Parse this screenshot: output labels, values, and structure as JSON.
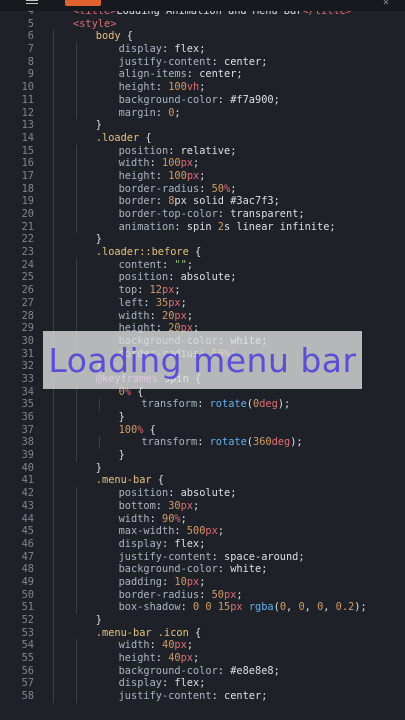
{
  "editor": {
    "lines": [
      {
        "n": "4",
        "indent": 3,
        "tokens": [
          [
            "t-tag",
            "<title>"
          ],
          [
            "t-plain",
            "Loading Animation and Menu Bar"
          ],
          [
            "t-tag",
            "</title>"
          ]
        ]
      },
      {
        "n": "5",
        "indent": 3,
        "tokens": [
          [
            "t-tag",
            "<style>"
          ]
        ]
      },
      {
        "n": "6",
        "indent": 4,
        "tokens": [
          [
            "t-sel",
            "body"
          ],
          [
            "t-plain",
            " {"
          ]
        ]
      },
      {
        "n": "7",
        "indent": 5,
        "tokens": [
          [
            "t-prop",
            "display"
          ],
          [
            "t-plain",
            ": flex;"
          ]
        ]
      },
      {
        "n": "8",
        "indent": 5,
        "tokens": [
          [
            "t-prop",
            "justify-content"
          ],
          [
            "t-plain",
            ": center;"
          ]
        ]
      },
      {
        "n": "9",
        "indent": 5,
        "tokens": [
          [
            "t-prop",
            "align-items"
          ],
          [
            "t-plain",
            ": center;"
          ]
        ]
      },
      {
        "n": "10",
        "indent": 5,
        "tokens": [
          [
            "t-prop",
            "height"
          ],
          [
            "t-plain",
            ": "
          ],
          [
            "t-num",
            "100"
          ],
          [
            "t-unit",
            "vh"
          ],
          [
            "t-plain",
            ";"
          ]
        ]
      },
      {
        "n": "11",
        "indent": 5,
        "tokens": [
          [
            "t-prop",
            "background-color"
          ],
          [
            "t-plain",
            ": #f7a900;"
          ]
        ]
      },
      {
        "n": "12",
        "indent": 5,
        "tokens": [
          [
            "t-prop",
            "margin"
          ],
          [
            "t-plain",
            ": "
          ],
          [
            "t-num",
            "0"
          ],
          [
            "t-plain",
            ";"
          ]
        ]
      },
      {
        "n": "13",
        "indent": 4,
        "tokens": [
          [
            "t-plain",
            "}"
          ]
        ]
      },
      {
        "n": "14",
        "indent": 4,
        "tokens": [
          [
            "t-sel",
            ".loader"
          ],
          [
            "t-plain",
            " {"
          ]
        ]
      },
      {
        "n": "15",
        "indent": 5,
        "tokens": [
          [
            "t-prop",
            "position"
          ],
          [
            "t-plain",
            ": relative;"
          ]
        ]
      },
      {
        "n": "16",
        "indent": 5,
        "tokens": [
          [
            "t-prop",
            "width"
          ],
          [
            "t-plain",
            ": "
          ],
          [
            "t-num",
            "100"
          ],
          [
            "t-unit",
            "px"
          ],
          [
            "t-plain",
            ";"
          ]
        ]
      },
      {
        "n": "17",
        "indent": 5,
        "tokens": [
          [
            "t-prop",
            "height"
          ],
          [
            "t-plain",
            ": "
          ],
          [
            "t-num",
            "100"
          ],
          [
            "t-unit",
            "px"
          ],
          [
            "t-plain",
            ";"
          ]
        ]
      },
      {
        "n": "18",
        "indent": 5,
        "tokens": [
          [
            "t-prop",
            "border-radius"
          ],
          [
            "t-plain",
            ": "
          ],
          [
            "t-num",
            "50"
          ],
          [
            "t-unit",
            "%"
          ],
          [
            "t-plain",
            ";"
          ]
        ]
      },
      {
        "n": "19",
        "indent": 5,
        "tokens": [
          [
            "t-prop",
            "border"
          ],
          [
            "t-plain",
            ": "
          ],
          [
            "t-num",
            "8"
          ],
          [
            "t-plain",
            "px solid #3ac7f3;"
          ]
        ]
      },
      {
        "n": "20",
        "indent": 5,
        "tokens": [
          [
            "t-prop",
            "border-top-color"
          ],
          [
            "t-plain",
            ": transparent;"
          ]
        ]
      },
      {
        "n": "21",
        "indent": 5,
        "tokens": [
          [
            "t-prop",
            "animation"
          ],
          [
            "t-plain",
            ": spin "
          ],
          [
            "t-num",
            "2"
          ],
          [
            "t-plain",
            "s linear infinite;"
          ]
        ]
      },
      {
        "n": "22",
        "indent": 4,
        "tokens": [
          [
            "t-plain",
            "}"
          ]
        ]
      },
      {
        "n": "23",
        "indent": 4,
        "tokens": [
          [
            "t-sel",
            ".loader::before"
          ],
          [
            "t-plain",
            " {"
          ]
        ]
      },
      {
        "n": "24",
        "indent": 5,
        "tokens": [
          [
            "t-prop",
            "content"
          ],
          [
            "t-plain",
            ": "
          ],
          [
            "t-str",
            "\"\""
          ],
          [
            "t-plain",
            ";"
          ]
        ]
      },
      {
        "n": "25",
        "indent": 5,
        "tokens": [
          [
            "t-prop",
            "position"
          ],
          [
            "t-plain",
            ": absolute;"
          ]
        ]
      },
      {
        "n": "26",
        "indent": 5,
        "tokens": [
          [
            "t-prop",
            "top"
          ],
          [
            "t-plain",
            ": "
          ],
          [
            "t-num",
            "12"
          ],
          [
            "t-unit",
            "px"
          ],
          [
            "t-plain",
            ";"
          ]
        ]
      },
      {
        "n": "27",
        "indent": 5,
        "tokens": [
          [
            "t-prop",
            "left"
          ],
          [
            "t-plain",
            ": "
          ],
          [
            "t-num",
            "35"
          ],
          [
            "t-unit",
            "px"
          ],
          [
            "t-plain",
            ";"
          ]
        ]
      },
      {
        "n": "28",
        "indent": 5,
        "tokens": [
          [
            "t-prop",
            "width"
          ],
          [
            "t-plain",
            ": "
          ],
          [
            "t-num",
            "20"
          ],
          [
            "t-unit",
            "px"
          ],
          [
            "t-plain",
            ";"
          ]
        ]
      },
      {
        "n": "29",
        "indent": 5,
        "tokens": [
          [
            "t-prop",
            "height"
          ],
          [
            "t-plain",
            ": "
          ],
          [
            "t-num",
            "20"
          ],
          [
            "t-unit",
            "px"
          ],
          [
            "t-plain",
            ";"
          ]
        ]
      },
      {
        "n": "30",
        "indent": 5,
        "tokens": [
          [
            "t-prop",
            "background-color"
          ],
          [
            "t-plain",
            ": white;"
          ]
        ]
      },
      {
        "n": "31",
        "indent": 5,
        "tokens": [
          [
            "t-prop",
            "border-radius"
          ],
          [
            "t-plain",
            ": "
          ],
          [
            "t-num",
            "50"
          ],
          [
            "t-unit",
            "%"
          ],
          [
            "t-plain",
            ";"
          ]
        ]
      },
      {
        "n": "32",
        "indent": 4,
        "tokens": [
          [
            "t-plain",
            "}"
          ]
        ]
      },
      {
        "n": "33",
        "indent": 4,
        "tokens": [
          [
            "t-kw",
            "@keyframes"
          ],
          [
            "t-plain",
            " spin {"
          ]
        ]
      },
      {
        "n": "34",
        "indent": 5,
        "tokens": [
          [
            "t-num",
            "0"
          ],
          [
            "t-unit",
            "%"
          ],
          [
            "t-plain",
            " {"
          ]
        ]
      },
      {
        "n": "35",
        "indent": 6,
        "tokens": [
          [
            "t-prop",
            "transform"
          ],
          [
            "t-plain",
            ": "
          ],
          [
            "t-fn",
            "rotate"
          ],
          [
            "t-plain",
            "("
          ],
          [
            "t-num",
            "0"
          ],
          [
            "t-unit",
            "deg"
          ],
          [
            "t-plain",
            ");"
          ]
        ]
      },
      {
        "n": "36",
        "indent": 5,
        "tokens": [
          [
            "t-plain",
            "}"
          ]
        ]
      },
      {
        "n": "37",
        "indent": 5,
        "tokens": [
          [
            "t-num",
            "100"
          ],
          [
            "t-unit",
            "%"
          ],
          [
            "t-plain",
            " {"
          ]
        ]
      },
      {
        "n": "38",
        "indent": 6,
        "tokens": [
          [
            "t-prop",
            "transform"
          ],
          [
            "t-plain",
            ": "
          ],
          [
            "t-fn",
            "rotate"
          ],
          [
            "t-plain",
            "("
          ],
          [
            "t-num",
            "360"
          ],
          [
            "t-unit",
            "deg"
          ],
          [
            "t-plain",
            ");"
          ]
        ]
      },
      {
        "n": "39",
        "indent": 5,
        "tokens": [
          [
            "t-plain",
            "}"
          ]
        ]
      },
      {
        "n": "40",
        "indent": 4,
        "tokens": [
          [
            "t-plain",
            "}"
          ]
        ]
      },
      {
        "n": "41",
        "indent": 4,
        "tokens": [
          [
            "t-sel",
            ".menu-bar"
          ],
          [
            "t-plain",
            " {"
          ]
        ]
      },
      {
        "n": "42",
        "indent": 5,
        "tokens": [
          [
            "t-prop",
            "position"
          ],
          [
            "t-plain",
            ": absolute;"
          ]
        ]
      },
      {
        "n": "43",
        "indent": 5,
        "tokens": [
          [
            "t-prop",
            "bottom"
          ],
          [
            "t-plain",
            ": "
          ],
          [
            "t-num",
            "30"
          ],
          [
            "t-unit",
            "px"
          ],
          [
            "t-plain",
            ";"
          ]
        ]
      },
      {
        "n": "44",
        "indent": 5,
        "tokens": [
          [
            "t-prop",
            "width"
          ],
          [
            "t-plain",
            ": "
          ],
          [
            "t-num",
            "90"
          ],
          [
            "t-unit",
            "%"
          ],
          [
            "t-plain",
            ";"
          ]
        ]
      },
      {
        "n": "45",
        "indent": 5,
        "tokens": [
          [
            "t-prop",
            "max-width"
          ],
          [
            "t-plain",
            ": "
          ],
          [
            "t-num",
            "500"
          ],
          [
            "t-unit",
            "px"
          ],
          [
            "t-plain",
            ";"
          ]
        ]
      },
      {
        "n": "46",
        "indent": 5,
        "tokens": [
          [
            "t-prop",
            "display"
          ],
          [
            "t-plain",
            ": flex;"
          ]
        ]
      },
      {
        "n": "47",
        "indent": 5,
        "tokens": [
          [
            "t-prop",
            "justify-content"
          ],
          [
            "t-plain",
            ": space-around;"
          ]
        ]
      },
      {
        "n": "48",
        "indent": 5,
        "tokens": [
          [
            "t-prop",
            "background-color"
          ],
          [
            "t-plain",
            ": white;"
          ]
        ]
      },
      {
        "n": "49",
        "indent": 5,
        "tokens": [
          [
            "t-prop",
            "padding"
          ],
          [
            "t-plain",
            ": "
          ],
          [
            "t-num",
            "10"
          ],
          [
            "t-unit",
            "px"
          ],
          [
            "t-plain",
            ";"
          ]
        ]
      },
      {
        "n": "50",
        "indent": 5,
        "tokens": [
          [
            "t-prop",
            "border-radius"
          ],
          [
            "t-plain",
            ": "
          ],
          [
            "t-num",
            "50"
          ],
          [
            "t-unit",
            "px"
          ],
          [
            "t-plain",
            ";"
          ]
        ]
      },
      {
        "n": "51",
        "indent": 5,
        "tokens": [
          [
            "t-prop",
            "box-shadow"
          ],
          [
            "t-plain",
            ": "
          ],
          [
            "t-num",
            "0"
          ],
          [
            "t-plain",
            " "
          ],
          [
            "t-num",
            "0"
          ],
          [
            "t-plain",
            " "
          ],
          [
            "t-num",
            "15"
          ],
          [
            "t-unit",
            "px"
          ],
          [
            "t-plain",
            " "
          ],
          [
            "t-fn",
            "rgba"
          ],
          [
            "t-plain",
            "("
          ],
          [
            "t-num",
            "0"
          ],
          [
            "t-plain",
            ", "
          ],
          [
            "t-num",
            "0"
          ],
          [
            "t-plain",
            ", "
          ],
          [
            "t-num",
            "0"
          ],
          [
            "t-plain",
            ", "
          ],
          [
            "t-num",
            "0.2"
          ],
          [
            "t-plain",
            ");"
          ]
        ]
      },
      {
        "n": "52",
        "indent": 4,
        "tokens": [
          [
            "t-plain",
            "}"
          ]
        ]
      },
      {
        "n": "53",
        "indent": 4,
        "tokens": [
          [
            "t-sel",
            ".menu-bar .icon"
          ],
          [
            "t-plain",
            " {"
          ]
        ]
      },
      {
        "n": "54",
        "indent": 5,
        "tokens": [
          [
            "t-prop",
            "width"
          ],
          [
            "t-plain",
            ": "
          ],
          [
            "t-num",
            "40"
          ],
          [
            "t-unit",
            "px"
          ],
          [
            "t-plain",
            ";"
          ]
        ]
      },
      {
        "n": "55",
        "indent": 5,
        "tokens": [
          [
            "t-prop",
            "height"
          ],
          [
            "t-plain",
            ": "
          ],
          [
            "t-num",
            "40"
          ],
          [
            "t-unit",
            "px"
          ],
          [
            "t-plain",
            ";"
          ]
        ]
      },
      {
        "n": "56",
        "indent": 5,
        "tokens": [
          [
            "t-prop",
            "background-color"
          ],
          [
            "t-plain",
            ": #e8e8e8;"
          ]
        ]
      },
      {
        "n": "57",
        "indent": 5,
        "tokens": [
          [
            "t-prop",
            "display"
          ],
          [
            "t-plain",
            ": flex;"
          ]
        ]
      },
      {
        "n": "58",
        "indent": 5,
        "tokens": [
          [
            "t-prop",
            "justify-content"
          ],
          [
            "t-plain",
            ": center;"
          ]
        ]
      }
    ]
  },
  "overlay": {
    "caption": "Loading menu bar"
  },
  "colors": {
    "background": "#1e2228",
    "caption": "#5b4fd6"
  }
}
